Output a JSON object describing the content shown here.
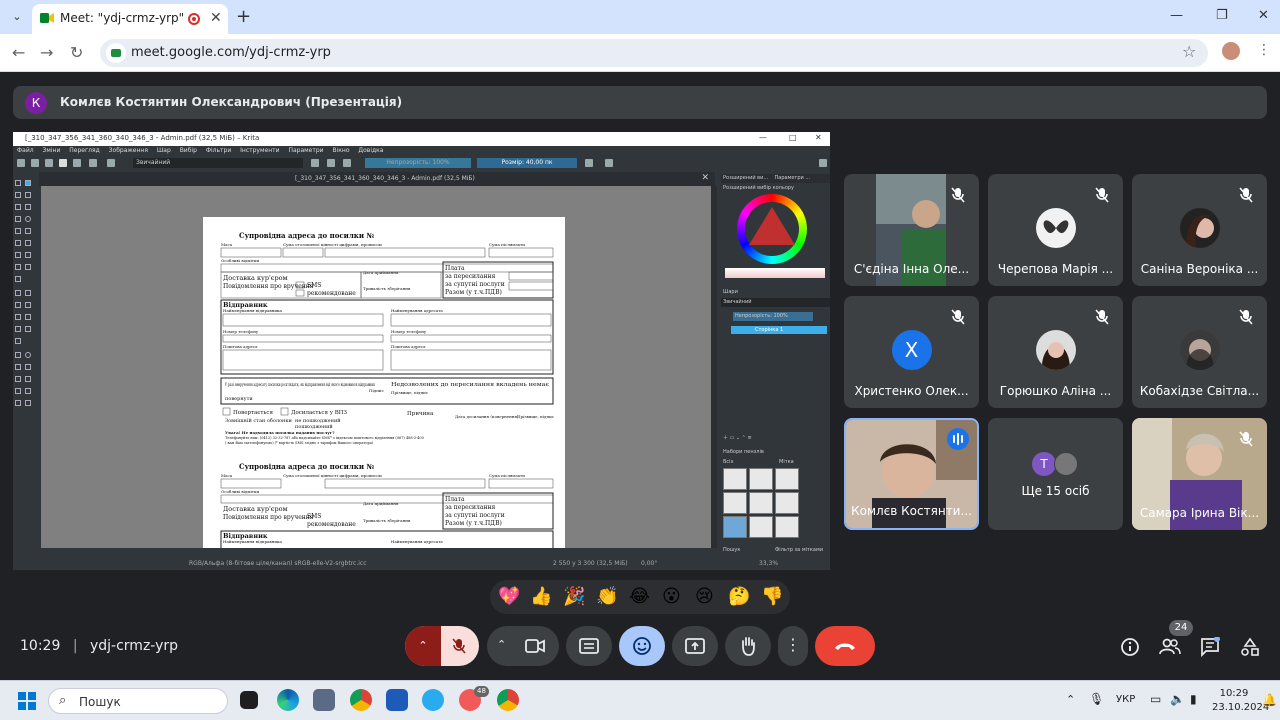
{
  "browser": {
    "tab_title": "Meet: \"ydj-crmz-yrp\"",
    "url": "meet.google.com/ydj-crmz-yrp"
  },
  "presenter": {
    "initial": "К",
    "label": "Комлєв Костянтин Олександрович (Презентація)"
  },
  "krita": {
    "title": "[_310_347_356_341_360_340_346_3 - Admin.pdf (32,5 МіБ) – Krita",
    "menu": [
      "Файл",
      "Зміни",
      "Перегляд",
      "Зображення",
      "Шар",
      "Вибір",
      "Фільтри",
      "Інструменти",
      "Параметри",
      "Вікно",
      "Довідка"
    ],
    "brush_preset": "Звичайний",
    "opacity_label": "Непрозорість: 100%",
    "size_label": "Розмір: 40,00 пк",
    "doc_tab": "[_310_347_356_341_360_340_346_3 - Admin.pdf (32,5 МіБ)",
    "panel_tabs": [
      "Розширений ви...",
      "Параметри ..."
    ],
    "color_panel": "Розширений вибір кольору",
    "layers_panel": "Шари",
    "blend_mode": "Звичайний",
    "layer_opacity": "Непрозорість: 100%",
    "layer_name": "Сторінка 1",
    "brush_panel": "Набори пензлів",
    "brush_tag": "Всіх",
    "brush_tag2": "Мітка",
    "brush_search": "Пошук",
    "brush_filter": "Фільтр за мітками",
    "status_left": "RGB/Альфа (8-бітове ціле/канал)  sRGB-elle-V2-srgbtrc.icc",
    "status_size": "2 550 у 3 300 (32,5 МіБ)",
    "status_angle": "0,00°",
    "status_zoom": "33,3%"
  },
  "form": {
    "title": "Супровідна адреса до посилки №",
    "mass": "Маса",
    "declared": "Сума оголошеної цінності цифрами, прописом",
    "cod": "Сума післяплати",
    "special": "Особливі відмітки",
    "courier": "Доставка кур'єром",
    "notify": "Повідомлення про вручення",
    "sms": "SMS",
    "registered": "рекомендоване",
    "accept_date": "Дата приймання",
    "storage": "Тривалість зберігання",
    "fee": "Плата",
    "forwarding": "за пересилання",
    "services": "за супутні послуги",
    "total": "Разом (у т.ч.ПДВ)",
    "sender": "Відправник",
    "sender_name": "Найменування відправника",
    "recipient_name": "Найменування адресата",
    "phone": "Номер телефону",
    "address": "Поштова адреса",
    "nondelivery": "У разі невручення адресату посилки розглядати, як відправлення від якого відмовився відправник",
    "sign": "Підпис",
    "return": "повернути",
    "forbidden": "Недозволених до пересилання вкладень немає",
    "prohibited": "Прізвище, підпис",
    "comes_back": "Повертається",
    "delivered": "Досилається у ВПЗ",
    "reason": "Причина",
    "outer": "Зовнішній стан оболонки",
    "intact": "не пошкоджений",
    "damaged": "пошкоджений",
    "ack_date": "Дата досилання (повернення)",
    "signer": "Прізвище, підпис",
    "note": "Увага! Не надходила посилка наданих послуг?",
    "note2": "Телефонуйте нам: (0412) 32-32-787 або надсилайте SMS* з індексом поштового відділення (067) 488-3-400",
    "note3": "( вам Вам зателефонуємо) (* вартість SMS згідно з тарифом Вашого оператора)"
  },
  "participants": [
    {
      "name": "С'єдіна Інна Оле...",
      "type": "video",
      "muted": true
    },
    {
      "name": "Черепова Марія ...",
      "type": "avatar",
      "muted": true
    },
    {
      "name": "Саніна Вероніка ...",
      "type": "avatar",
      "muted": true
    },
    {
      "name": "Христенко Олек...",
      "type": "initial",
      "initial": "Х",
      "color": "#1a73e8",
      "muted": true
    },
    {
      "name": "Горюшко Аліна ...",
      "type": "avatar",
      "muted": true
    },
    {
      "name": "Кобахідзе Світла...",
      "type": "avatar",
      "muted": true
    },
    {
      "name": "Комлєв Костянти...",
      "type": "video",
      "speaking": true
    },
    {
      "name": "Ще 15 осіб",
      "type": "more",
      "initial": "Т"
    },
    {
      "name": "Самара Ірина Вік...",
      "type": "video",
      "muted": true
    }
  ],
  "meeting": {
    "time": "10:29",
    "code": "ydj-crmz-yrp",
    "people_count": "24"
  },
  "reactions": [
    "💖",
    "👍",
    "🎉",
    "👏",
    "😂",
    "😮",
    "😢",
    "🤔",
    "👎"
  ],
  "taskbar": {
    "search": "Пошук",
    "lang": "УКР",
    "time": "10:29",
    "date": "23.10.2024",
    "telegram_badge": "48"
  },
  "colors": {
    "accent_blue": "#8ab4f8",
    "end_call": "#ea4335",
    "mic_off": "#f9dedc"
  }
}
